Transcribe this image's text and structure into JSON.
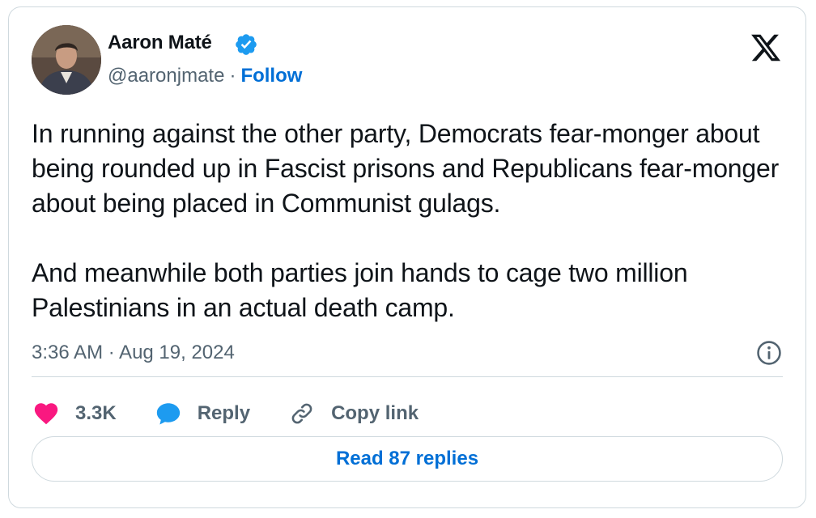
{
  "author": {
    "name": "Aaron Maté",
    "handle": "@aaronjmate",
    "separator": "·",
    "follow_label": "Follow",
    "verified": true
  },
  "tweet": {
    "paragraphs": [
      "In running against the other party, Democrats fear-monger about being rounded up in Fascist prisons and Republicans fear-monger about being placed in Communist gulags.",
      "And meanwhile both parties join hands to cage two million Palestinians in an actual death camp."
    ],
    "timestamp": "3:36 AM · Aug 19, 2024"
  },
  "actions": {
    "like_count": "3.3K",
    "reply_label": "Reply",
    "copy_link_label": "Copy link"
  },
  "footer": {
    "read_replies_label": "Read 87 replies"
  },
  "icons": {
    "like": "heart-icon",
    "reply": "speech-bubble-icon",
    "copy_link": "link-icon",
    "info": "info-icon",
    "brand": "x-logo-icon",
    "verified": "verified-badge-icon"
  },
  "colors": {
    "accent": "#006fd6",
    "like": "#f91880",
    "reply": "#1d9bf0",
    "verified": "#1d9bf0",
    "secondary_text": "#536471",
    "border": "#cfd9de"
  }
}
